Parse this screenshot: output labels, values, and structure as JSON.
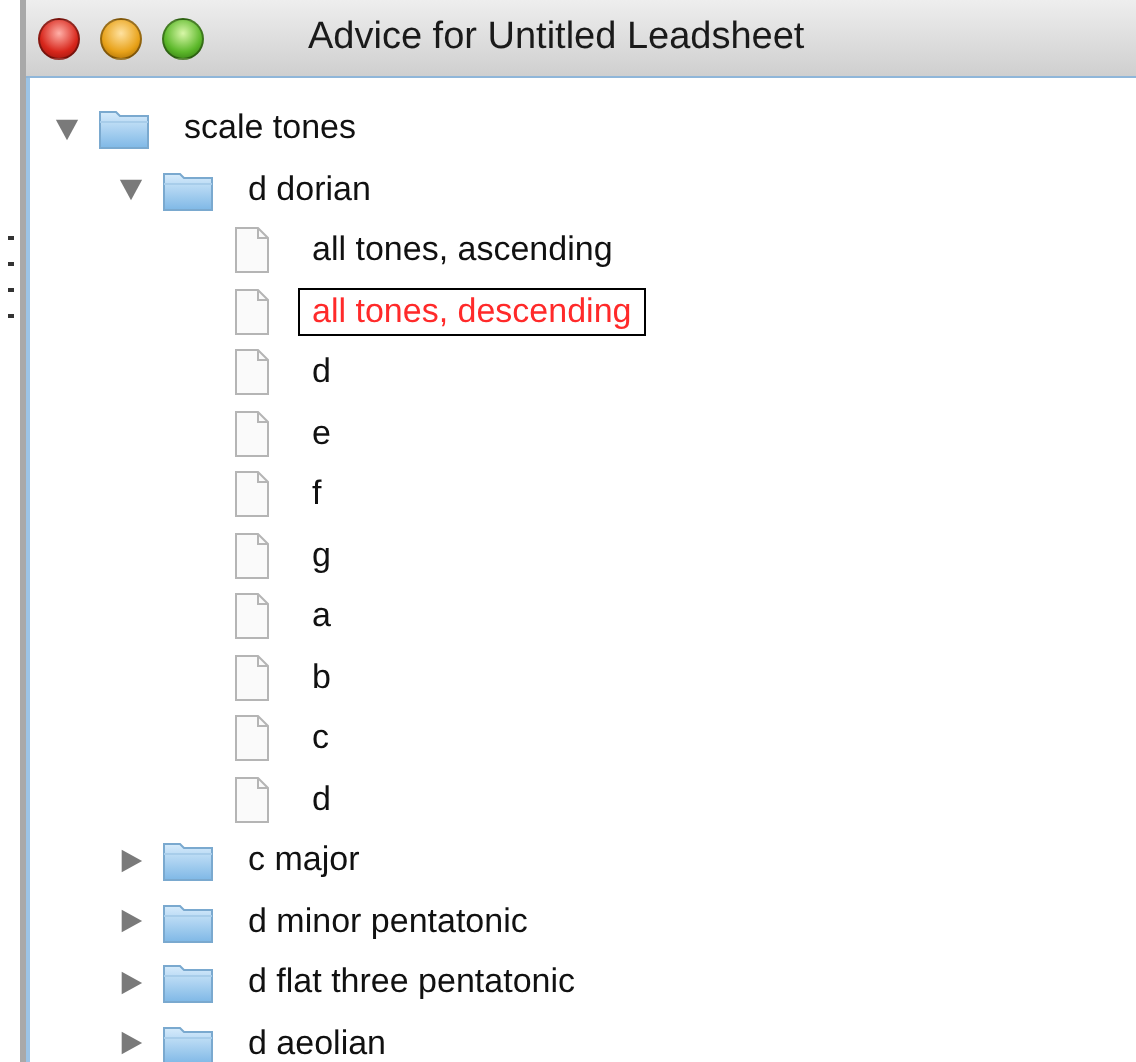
{
  "window": {
    "title": "Advice for Untitled Leadsheet"
  },
  "tree": [
    {
      "label": "scale tones",
      "kind": "folder",
      "expanded": true,
      "selected": false,
      "children": [
        {
          "label": "d dorian",
          "kind": "folder",
          "expanded": true,
          "selected": false,
          "children": [
            {
              "label": "all tones, ascending",
              "kind": "file",
              "selected": false
            },
            {
              "label": "all tones, descending",
              "kind": "file",
              "selected": true
            },
            {
              "label": "d",
              "kind": "file",
              "selected": false
            },
            {
              "label": "e",
              "kind": "file",
              "selected": false
            },
            {
              "label": "f",
              "kind": "file",
              "selected": false
            },
            {
              "label": "g",
              "kind": "file",
              "selected": false
            },
            {
              "label": "a",
              "kind": "file",
              "selected": false
            },
            {
              "label": "b",
              "kind": "file",
              "selected": false
            },
            {
              "label": "c",
              "kind": "file",
              "selected": false
            },
            {
              "label": "d",
              "kind": "file",
              "selected": false
            }
          ]
        },
        {
          "label": "c major",
          "kind": "folder",
          "expanded": false,
          "selected": false
        },
        {
          "label": "d minor pentatonic",
          "kind": "folder",
          "expanded": false,
          "selected": false
        },
        {
          "label": "d flat three pentatonic",
          "kind": "folder",
          "expanded": false,
          "selected": false
        },
        {
          "label": "d aeolian",
          "kind": "folder",
          "expanded": false,
          "selected": false
        }
      ]
    }
  ]
}
